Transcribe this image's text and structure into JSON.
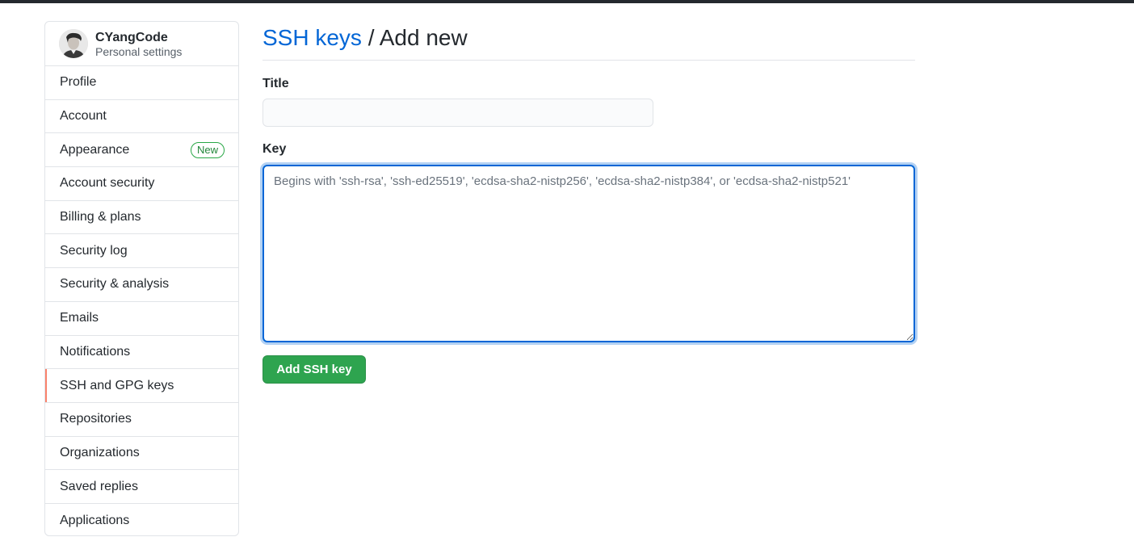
{
  "user": {
    "name": "CYangCode",
    "subtitle": "Personal settings",
    "avatar_icon": "user-avatar"
  },
  "sidebar": {
    "items": [
      {
        "label": "Profile"
      },
      {
        "label": "Account"
      },
      {
        "label": "Appearance",
        "badge": "New"
      },
      {
        "label": "Account security"
      },
      {
        "label": "Billing & plans"
      },
      {
        "label": "Security log"
      },
      {
        "label": "Security & analysis"
      },
      {
        "label": "Emails"
      },
      {
        "label": "Notifications"
      },
      {
        "label": "SSH and GPG keys",
        "selected": true
      },
      {
        "label": "Repositories"
      },
      {
        "label": "Organizations"
      },
      {
        "label": "Saved replies"
      },
      {
        "label": "Applications"
      }
    ]
  },
  "main": {
    "breadcrumb_link": "SSH keys",
    "breadcrumb_sep": " / ",
    "breadcrumb_current": "Add new",
    "title_label": "Title",
    "title_value": "",
    "key_label": "Key",
    "key_placeholder": "Begins with 'ssh-rsa', 'ssh-ed25519', 'ecdsa-sha2-nistp256', 'ecdsa-sha2-nistp384', or 'ecdsa-sha2-nistp521'",
    "submit_label": "Add SSH key"
  },
  "colors": {
    "link": "#0366d6",
    "primary_button": "#2ea44f",
    "selected_indicator": "#f9826c",
    "badge_green": "#28a745"
  }
}
